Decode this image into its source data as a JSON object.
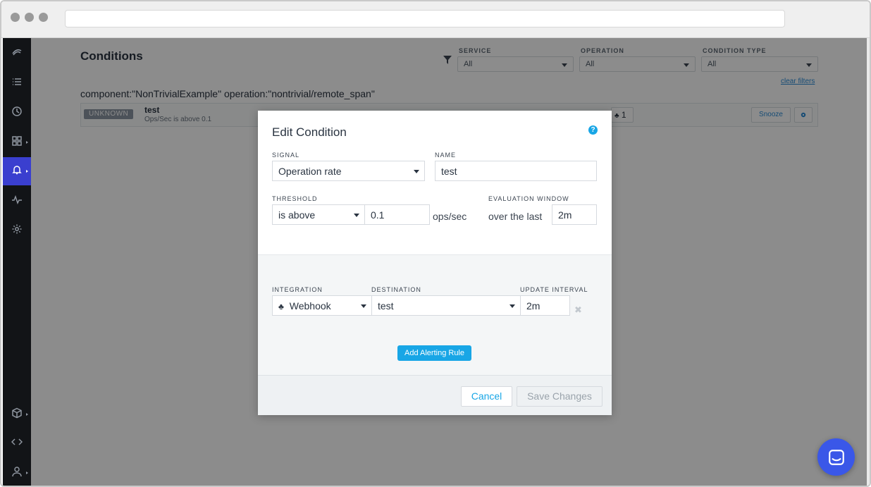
{
  "page": {
    "title": "Conditions",
    "query": "component:\"NonTrivialExample\" operation:\"nontrivial/remote_span\"",
    "clear_filters": "clear filters"
  },
  "filters": [
    {
      "label": "SERVICE",
      "value": "All"
    },
    {
      "label": "OPERATION",
      "value": "All"
    },
    {
      "label": "CONDITION TYPE",
      "value": "All"
    }
  ],
  "condition_row": {
    "status": "UNKNOWN",
    "name": "test",
    "description": "Ops/Sec is above 0.1",
    "rule_count": "1",
    "snooze_label": "Snooze"
  },
  "sidebar": {
    "items": [
      {
        "icon": "logo-icon"
      },
      {
        "icon": "list-icon"
      },
      {
        "icon": "clock-icon"
      },
      {
        "icon": "dashboard-icon"
      },
      {
        "icon": "bell-icon",
        "active": true
      },
      {
        "icon": "activity-icon"
      },
      {
        "icon": "gear-icon"
      },
      {
        "icon": "cube-icon"
      },
      {
        "icon": "code-icon"
      },
      {
        "icon": "user-icon"
      }
    ]
  },
  "modal": {
    "title": "Edit Condition",
    "help": "?",
    "signal": {
      "label": "SIGNAL",
      "value": "Operation rate"
    },
    "name": {
      "label": "NAME",
      "value": "test"
    },
    "threshold": {
      "label": "THRESHOLD",
      "operator": "is above",
      "value": "0.1",
      "unit": "ops/sec"
    },
    "evaluation_window": {
      "label": "EVALUATION WINDOW",
      "prefix": "over the last",
      "value": "2m"
    },
    "rule": {
      "integration_label": "INTEGRATION",
      "integration_value": "Webhook",
      "destination_label": "DESTINATION",
      "destination_value": "test",
      "interval_label": "UPDATE INTERVAL",
      "interval_value": "2m",
      "remove": "✖"
    },
    "add_rule_label": "Add Alerting Rule",
    "cancel_label": "Cancel",
    "save_label": "Save Changes"
  },
  "colors": {
    "accent": "#18a6e6",
    "sidebar_bg": "#121417",
    "sidebar_active": "#3a3fcf",
    "chat_launcher": "#3a57e8"
  }
}
